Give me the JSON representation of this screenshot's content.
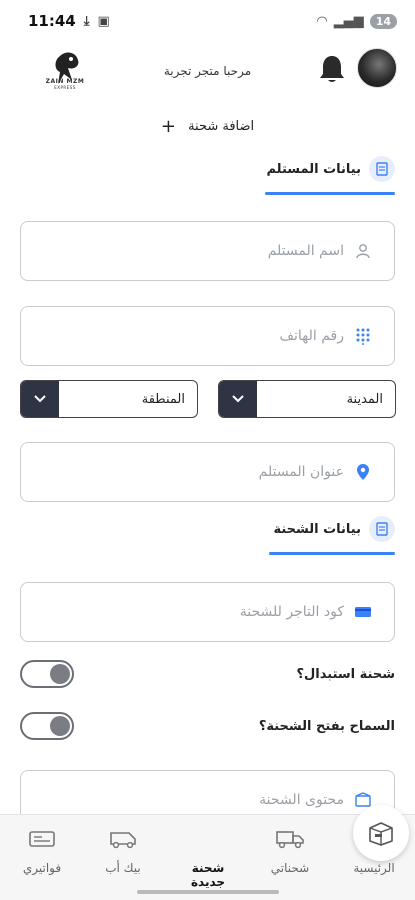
{
  "status_bar": {
    "time": "11:44",
    "battery": "14"
  },
  "header": {
    "greeting": "مرحبا متجر تجربة",
    "logo_name": "ZAIN MZM",
    "logo_sub": "EXPRESS"
  },
  "add_shipment": {
    "label": "اضافة شحنة"
  },
  "recipient_section": {
    "title": "بيانات المستلم",
    "name_placeholder": "اسم المستلم",
    "phone_placeholder": "رقم الهاتف",
    "city_select": "المدينة",
    "region_select": "المنطقة",
    "address_placeholder": "عنوان المستلم"
  },
  "shipment_section": {
    "title": "بيانات الشحنة",
    "merchant_code_placeholder": "كود التاجر للشحنة",
    "exchange_label": "شحنة استبدال؟",
    "allow_open_label": "السماح بفتح الشحنة؟",
    "content_placeholder": "محتوى الشحنة",
    "exchange_value": false,
    "allow_open_value": false
  },
  "bottom_nav": {
    "items": [
      {
        "label": "الرئيسية",
        "icon": "home-icon"
      },
      {
        "label": "شحناتي",
        "icon": "truck-icon"
      },
      {
        "label": "شحنة جديدة",
        "icon": "box-icon"
      },
      {
        "label": "بيك أب",
        "icon": "van-icon"
      },
      {
        "label": "فواتيري",
        "icon": "invoice-icon"
      }
    ]
  },
  "colors": {
    "accent": "#3b82f6",
    "select_dark": "#2f3445"
  }
}
